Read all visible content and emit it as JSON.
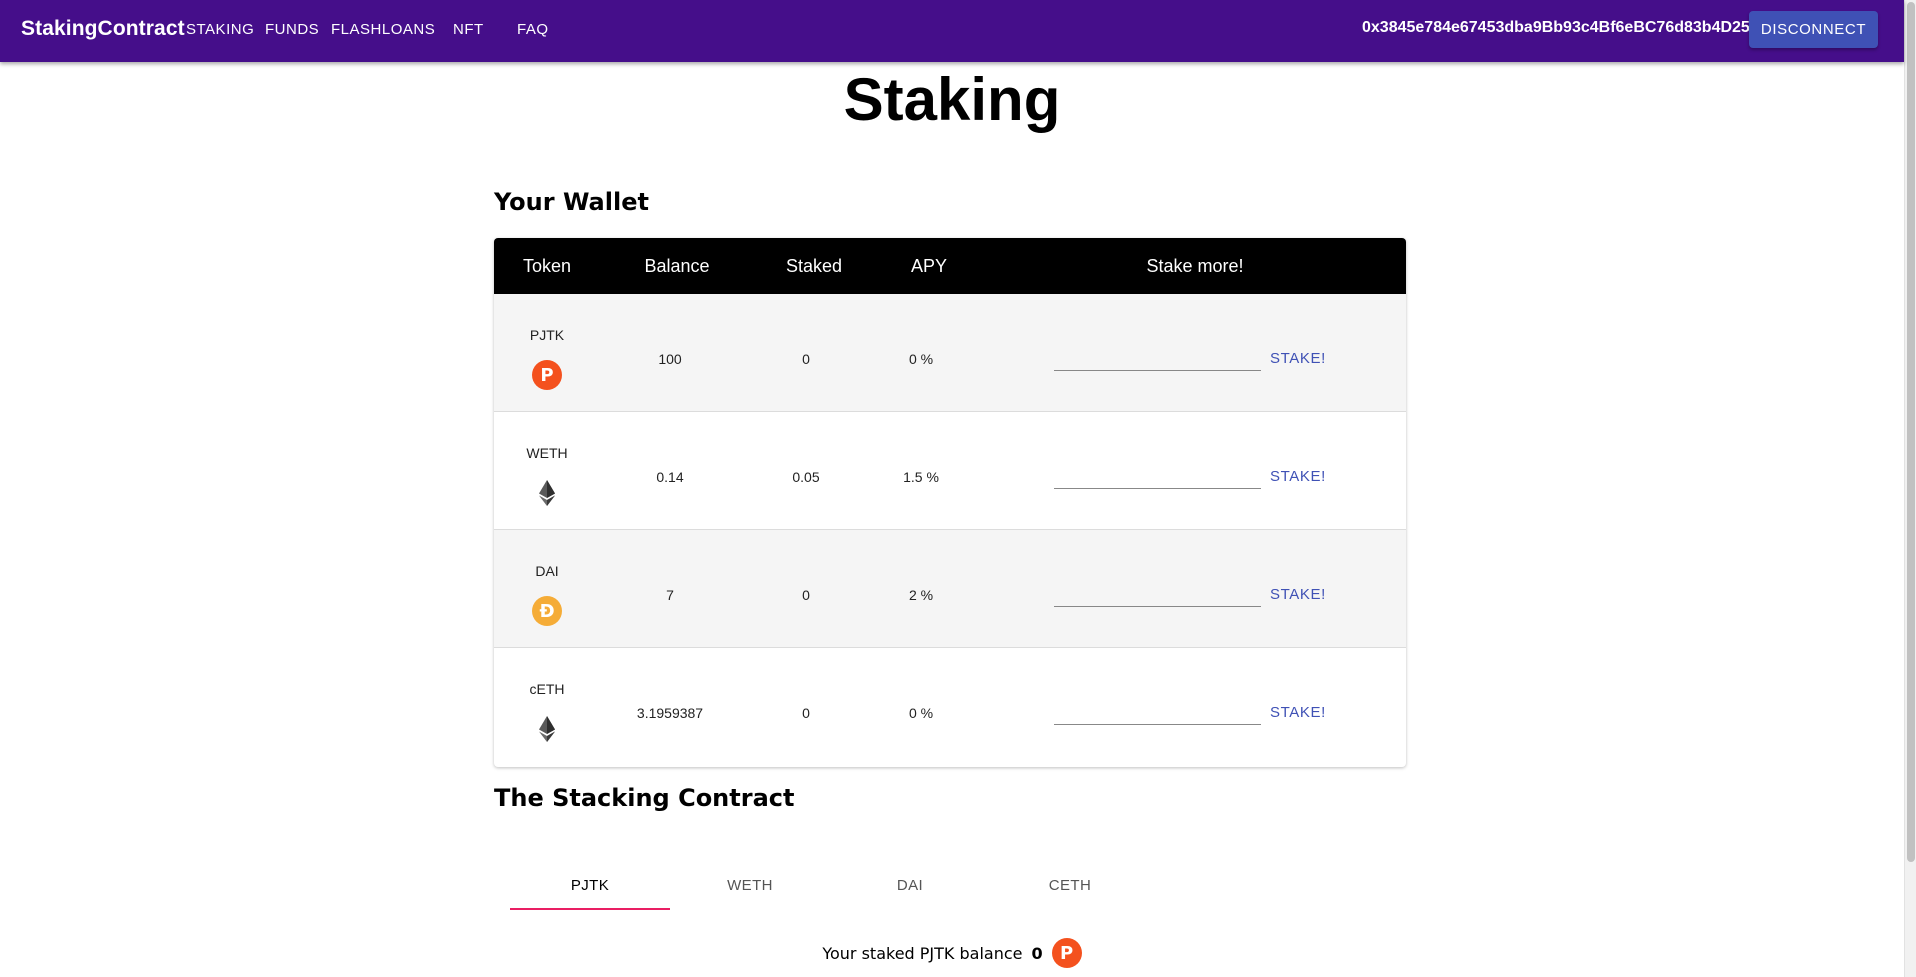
{
  "appbar": {
    "brand": "StakingContract",
    "nav": [
      "STAKING",
      "FUNDS",
      "FLASHLOANS",
      "NFT",
      "FAQ"
    ],
    "address": "0x3845e784e67453dba9Bb93c4Bf6eBC76d83b4D25",
    "disconnect_label": "DISCONNECT",
    "color": "#450e8a"
  },
  "page_title": "Staking",
  "wallet": {
    "title": "Your Wallet",
    "headers": {
      "token": "Token",
      "balance": "Balance",
      "staked": "Staked",
      "apy": "APY",
      "stake_more": "Stake more!"
    },
    "rows": [
      {
        "token": "PJTK",
        "icon": "pjtk-icon",
        "balance": "100",
        "staked": "0",
        "apy": "0 %",
        "stake_label": "STAKE!",
        "input_value": ""
      },
      {
        "token": "WETH",
        "icon": "ethereum-icon",
        "balance": "0.14",
        "staked": "0.05",
        "apy": "1.5 %",
        "stake_label": "STAKE!",
        "input_value": ""
      },
      {
        "token": "DAI",
        "icon": "dai-icon",
        "balance": "7",
        "staked": "0",
        "apy": "2 %",
        "stake_label": "STAKE!",
        "input_value": ""
      },
      {
        "token": "cETH",
        "icon": "ethereum-icon",
        "balance": "3.1959387",
        "staked": "0",
        "apy": "0 %",
        "stake_label": "STAKE!",
        "input_value": ""
      }
    ]
  },
  "contract": {
    "title": "The Stacking Contract",
    "tabs": [
      "PJTK",
      "WETH",
      "DAI",
      "CETH"
    ],
    "active_tab": "PJTK",
    "staked_prefix": "Your staked PJTK balance",
    "staked_value": "0",
    "accent": "#e91e63"
  },
  "colors": {
    "primary": "#3f51b5",
    "pjtk": "#f4511e",
    "dai": "#f5ac37"
  }
}
